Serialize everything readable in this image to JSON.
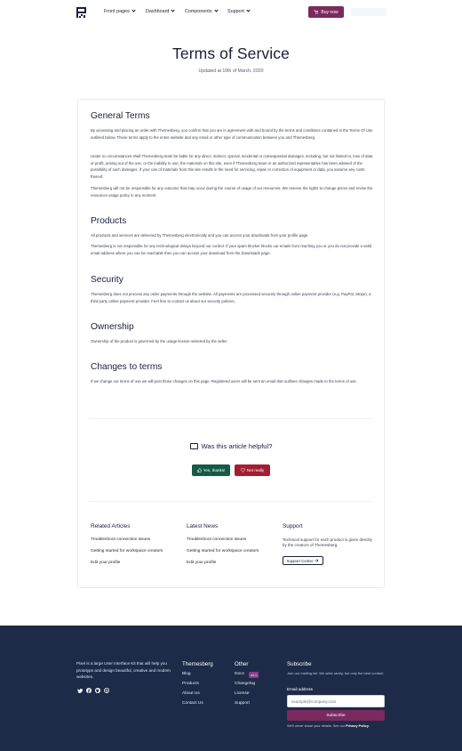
{
  "nav": {
    "items": [
      "Front pages",
      "Dashboard",
      "Components",
      "Support"
    ],
    "buy_label": "Buy now"
  },
  "header": {
    "title": "Terms of Service",
    "updated": "Updated at 10th of March, 2020"
  },
  "sections": [
    {
      "heading": "General Terms",
      "paragraphs": [
        "By accessing and placing an order with Themesberg, you confirm that you are in agreement with and bound by the terms and conditions contained in the Terms Of Use outlined below. These terms apply to the entire website and any email or other type of communication between you and Themesberg.",
        "Under no circumstances shall Themesberg team be liable for any direct, indirect, special, incidental or consequential damages, including, but not limited to, loss of data or profit, arising out of the use, or the inability to use, the materials on this site, even if Themesberg team or an authorized representative has been advised of the possibility of such damages. If your use of materials from this site results in the need for servicing, repair or correction of equipment or data, you assume any costs thereof.",
        "Themesberg will not be responsible for any outcome that may occur during the course of usage of our resources. We reserve the rights to change prices and revise the resources usage policy in any moment."
      ]
    },
    {
      "heading": "Products",
      "paragraphs": [
        "All products and services are delivered by Themesberg electronically and you can access your downloads from your profile page.",
        "Themesberg is not responsible for any technological delays beyond our control. If your spam blocker blocks our emails from reaching you or you do not provide a valid email address where you can be reachable then you can access your download from the Downloads page."
      ]
    },
    {
      "heading": "Security",
      "paragraphs": [
        "Themesberg does not process any order payments through the website. All payments are processed securely through online payment provider (e.g. PayPal, Stripe), a third party online payment provider. Feel free to contact us about our security policies."
      ]
    },
    {
      "heading": "Ownership",
      "paragraphs": [
        "Ownership of the product is governed by the usage license selected by the seller."
      ]
    },
    {
      "heading": "Changes to terms",
      "paragraphs": [
        "If we change our terms of use we will post those changes on this page. Registered users will be sent an email that outlines changes made to the terms of use."
      ]
    }
  ],
  "feedback": {
    "question": "Was this article helpful?",
    "yes_label": "Yes, thanks!",
    "no_label": "Not really"
  },
  "related": {
    "articles_title": "Related Articles",
    "articles": [
      "Troubleshoot connection issues",
      "Getting started for workspace creators",
      "Edit your profile"
    ],
    "news_title": "Latest News",
    "news": [
      "Troubleshoot connection issues",
      "Getting started for workspace creators",
      "Edit your profile"
    ],
    "support_title": "Support",
    "support_text": "Technical support for each product is given directly by the creators of Themesberg.",
    "support_button": "Support Center"
  },
  "footer": {
    "about": "Pixel is a large User Interface Kit that will help you prototype and design beautiful, creative and modern websites.",
    "col1_title": "Themesberg",
    "col1_links": [
      "Blog",
      "Products",
      "About Us",
      "Contact Us"
    ],
    "col2_title": "Other",
    "col2_links": [
      "Docs",
      "Changelog",
      "License",
      "Support"
    ],
    "docs_badge": "v3.1",
    "subscribe_title": "Subscribe",
    "subscribe_text": "Join our mailing list. We write rarely, but only the best content.",
    "email_label": "Email address",
    "email_placeholder": "example@company.com",
    "subscribe_button": "Subscribe",
    "note_prefix": "We'll never share your details. See our",
    "note_link": "Privacy Policy."
  },
  "colors": {
    "brand": "#7a2a5e",
    "navy": "#1d2b49",
    "success": "#145a47",
    "danger": "#a41e32"
  }
}
